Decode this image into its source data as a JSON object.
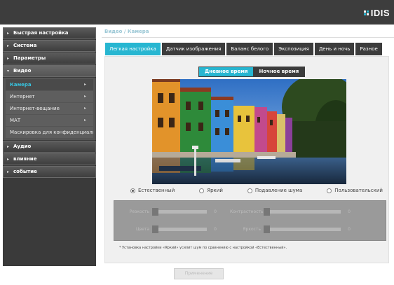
{
  "brand": {
    "logo_text": "IDIS"
  },
  "sidebar": {
    "items": [
      {
        "label": "Быстрая настройка"
      },
      {
        "label": "Система"
      },
      {
        "label": "Параметры"
      },
      {
        "label": "Видео"
      },
      {
        "label": "Аудио"
      },
      {
        "label": "влияние"
      },
      {
        "label": "событие"
      }
    ],
    "video_sub": [
      {
        "label": "Камера"
      },
      {
        "label": "Интернет"
      },
      {
        "label": "Интернет-вещание"
      },
      {
        "label": "МАТ"
      },
      {
        "label": "Маскировка для конфиденциальности"
      }
    ]
  },
  "breadcrumb": "Видео / Камера",
  "tabs": [
    {
      "label": "Легкая настройка"
    },
    {
      "label": "Датчик изображения"
    },
    {
      "label": "Баланс белого"
    },
    {
      "label": "Экспозиция"
    },
    {
      "label": "День и ночь"
    },
    {
      "label": "Разное"
    }
  ],
  "mode": {
    "day": "Дневное время",
    "night": "Ночное время"
  },
  "presets": [
    {
      "label": "Естественный",
      "selected": true
    },
    {
      "label": "Яркий",
      "selected": false
    },
    {
      "label": "Подавление шума",
      "selected": false
    },
    {
      "label": "Пользовательский",
      "selected": false
    }
  ],
  "sliders": [
    {
      "label": "Резкость",
      "value": "0",
      "level": 0
    },
    {
      "label": "Контрастность",
      "value": "0",
      "level": 0
    },
    {
      "label": "Цвета",
      "value": "0",
      "level": 0
    },
    {
      "label": "Яркость",
      "value": "0",
      "level": 0
    }
  ],
  "note": "* Установка настройки «Яркий» усилит шум по сравнению с настройкой «Естественный».",
  "apply_button": "Применение",
  "colors": {
    "accent": "#27b6d1",
    "dark": "#3c3c3c"
  }
}
